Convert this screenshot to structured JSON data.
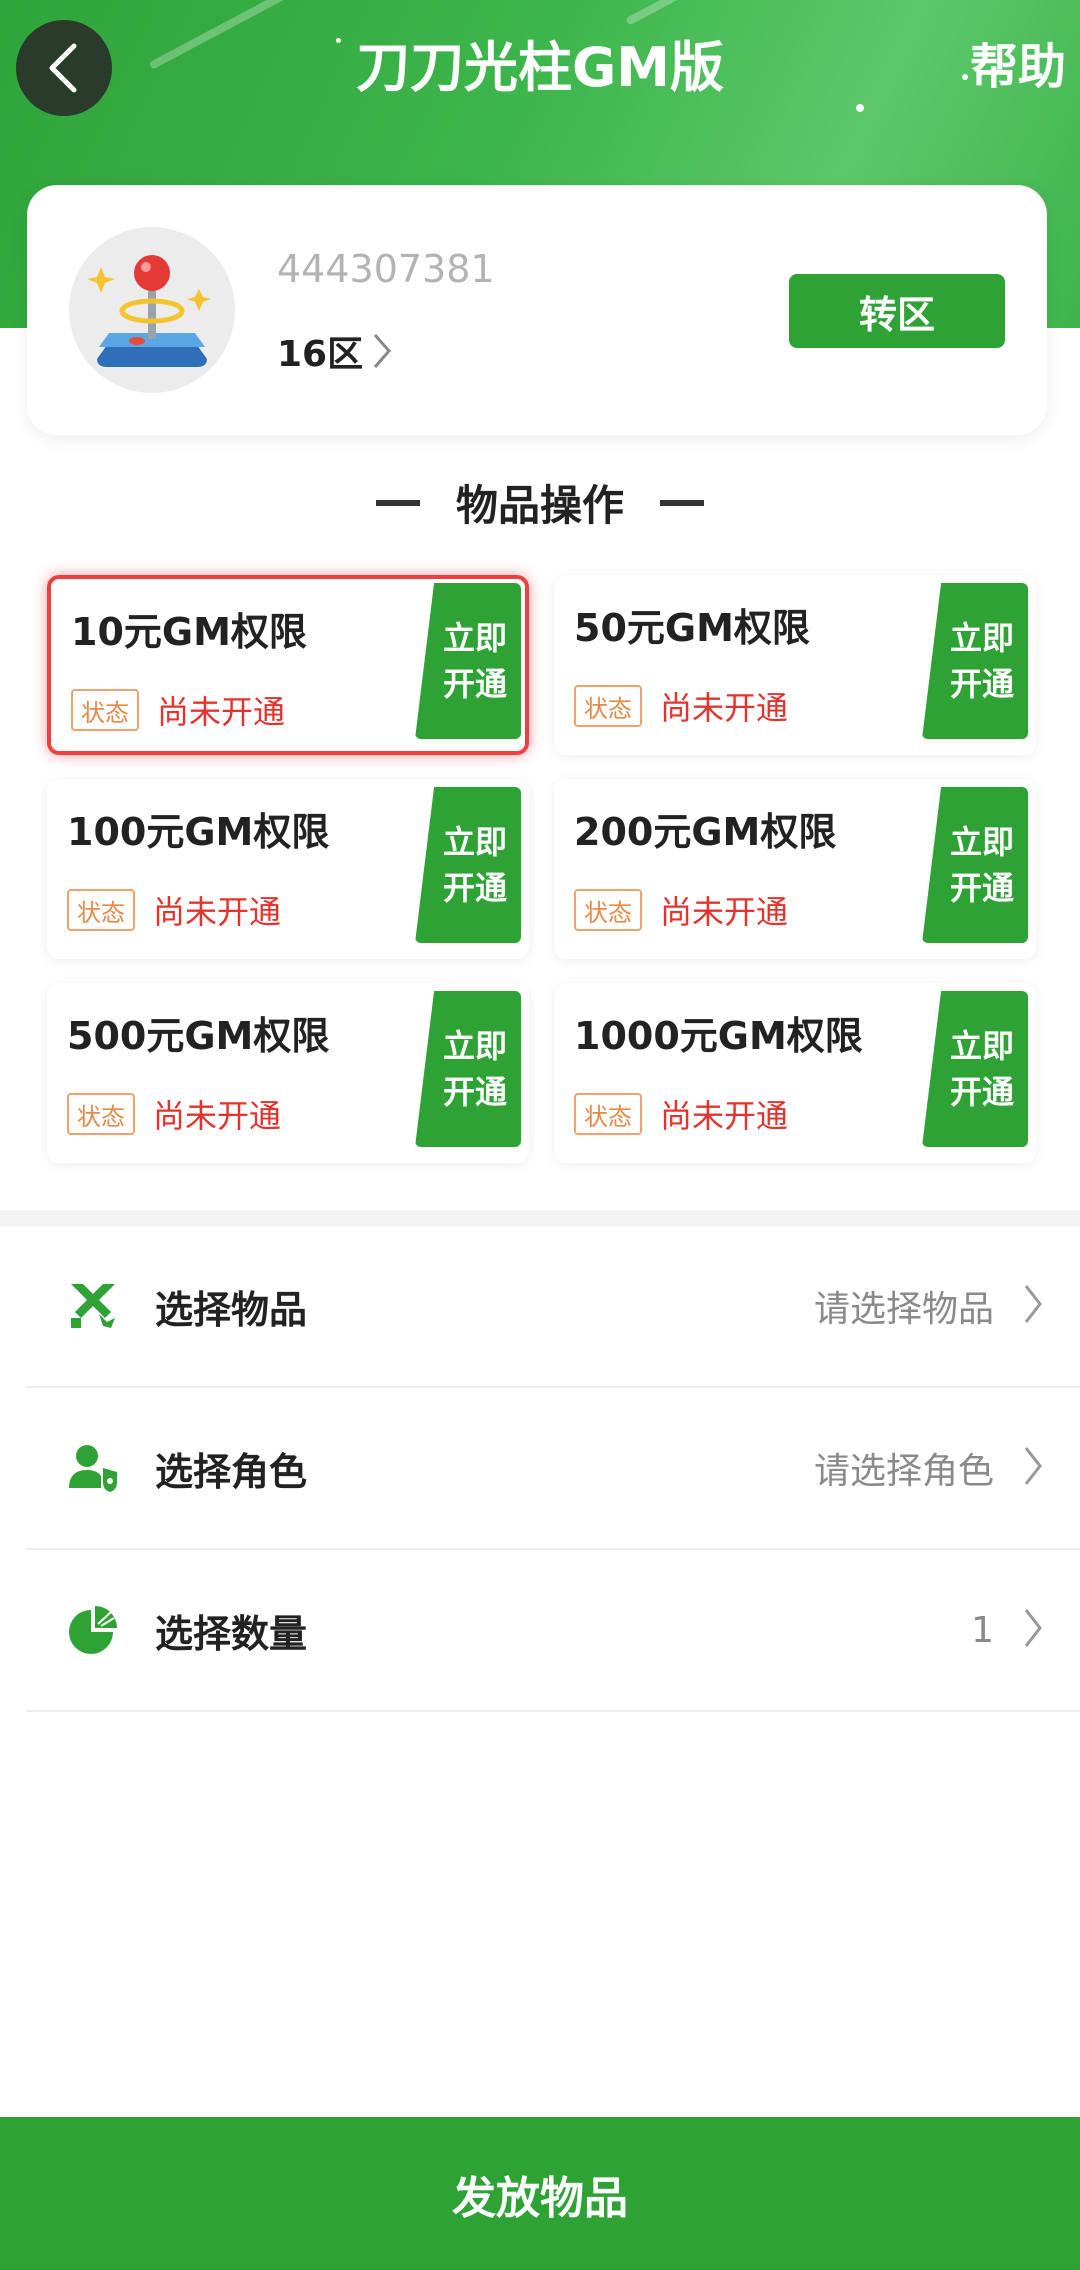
{
  "header": {
    "title": "刀刀光柱GM版",
    "help_label": "帮助"
  },
  "profile": {
    "uid": "444307381",
    "server": "16区",
    "switch_label": "转区"
  },
  "section": {
    "title": "物品操作"
  },
  "gm_items": [
    {
      "name": "10元GM权限",
      "status_tag": "状态",
      "status": "尚未开通",
      "btn_line1": "立即",
      "btn_line2": "开通"
    },
    {
      "name": "50元GM权限",
      "status_tag": "状态",
      "status": "尚未开通",
      "btn_line1": "立即",
      "btn_line2": "开通"
    },
    {
      "name": "100元GM权限",
      "status_tag": "状态",
      "status": "尚未开通",
      "btn_line1": "立即",
      "btn_line2": "开通"
    },
    {
      "name": "200元GM权限",
      "status_tag": "状态",
      "status": "尚未开通",
      "btn_line1": "立即",
      "btn_line2": "开通"
    },
    {
      "name": "500元GM权限",
      "status_tag": "状态",
      "status": "尚未开通",
      "btn_line1": "立即",
      "btn_line2": "开通"
    },
    {
      "name": "1000元GM权限",
      "status_tag": "状态",
      "status": "尚未开通",
      "btn_line1": "立即",
      "btn_line2": "开通"
    }
  ],
  "form": {
    "item": {
      "label": "选择物品",
      "value": "请选择物品",
      "icon": "swords-icon"
    },
    "role": {
      "label": "选择角色",
      "value": "请选择角色",
      "icon": "user-shield-icon"
    },
    "quantity": {
      "label": "选择数量",
      "value": "1",
      "icon": "pie-chart-icon"
    }
  },
  "submit_label": "发放物品",
  "colors": {
    "primary_green": "#2ea235",
    "status_red": "#e5322d",
    "tag_orange": "#e58a48",
    "selected_border": "#ef3f3f"
  }
}
